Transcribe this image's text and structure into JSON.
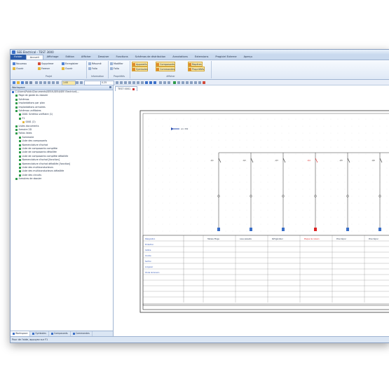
{
  "window": {
    "title": "SEE Electrical - TEST 3000"
  },
  "menu": {
    "items": [
      "Fichier",
      "Accueil",
      "Affichage",
      "Edition",
      "Afficher",
      "Dessiner",
      "Fonctions",
      "Schémas de distribution",
      "Annotations",
      "Extensions",
      "Progiciel Externe",
      "Aperçu"
    ]
  },
  "ribbon": {
    "projet": {
      "label": "Projet",
      "ouvrir": "Ouvrir",
      "fermer": "Fermer",
      "nouveau": "Nouveau",
      "supprimer": "Supprimer",
      "enregistrer": "Enregistrer",
      "ouvrir2": "Ouvrir"
    },
    "information": {
      "label": "Information",
      "resume": "Résumé",
      "folio": "Folio"
    },
    "proprietes": {
      "label": "Propriétés",
      "modifier": "Modifier",
      "folio": "Folio"
    },
    "afficher": {
      "label": "Afficher",
      "appareils": "Appareils",
      "symboles": "Symboles",
      "composants": "Composants",
      "commandes": "Commandes",
      "repere": "Repères",
      "proprietes": "Propriétés"
    }
  },
  "toolbar": {
    "zoom": "1:00",
    "scale": "0.25"
  },
  "workspace": {
    "title": "Workspace",
    "tree": [
      {
        "label": "C:\\Users\\Public\\Documents\\SEE4\\SEE4\\SEE Electrical\\...",
        "level": 0
      },
      {
        "label": "Page de garde du dossier",
        "level": 1
      },
      {
        "label": "Schémas",
        "level": 1
      },
      {
        "label": "Implantations par plan",
        "level": 1
      },
      {
        "label": "Implantations armoires",
        "level": 1
      },
      {
        "label": "Schémas unifilaires",
        "level": 1
      },
      {
        "label": "0001 Schéma unifilaire (1)",
        "level": 2
      },
      {
        "label": "F1",
        "level": 2
      },
      {
        "label": "0001 (2)",
        "level": 3
      },
      {
        "label": "Listes documents",
        "level": 1
      },
      {
        "label": "Armoire 2D",
        "level": 1
      },
      {
        "label": "Folios listes",
        "level": 1
      },
      {
        "label": "Sommaire",
        "level": 2
      },
      {
        "label": "Liste des composants",
        "level": 2
      },
      {
        "label": "Nomenclature d'achat",
        "level": 2
      },
      {
        "label": "Liste de composants complète",
        "level": 2
      },
      {
        "label": "Liste de composants détaillée",
        "level": 2
      },
      {
        "label": "Liste de composants complète détaillée",
        "level": 2
      },
      {
        "label": "Nomenclature d'achat [fonction]",
        "level": 2
      },
      {
        "label": "Nomenclature d'achat détaillée [fonction]",
        "level": 2
      },
      {
        "label": "Liste des multiconducteurs",
        "level": 2
      },
      {
        "label": "Liste des multiconducteurs détaillée",
        "level": 2
      },
      {
        "label": "Liste des circuits",
        "level": 2
      },
      {
        "label": "Armoires de dossier",
        "level": 1
      }
    ],
    "tabs": [
      "Workspace",
      "Symboles",
      "Composants",
      "Commandes"
    ]
  },
  "document": {
    "tab": "TEST 0001"
  },
  "status": "Pour de l'aide, appuyez sur F1",
  "schematic": {
    "source_label": "Arr. 330",
    "feeders": [
      {
        "ref": "-Q1",
        "desc": "Tableau Etage"
      },
      {
        "ref": "-Q2",
        "desc": "Lave-vaisselle"
      },
      {
        "ref": "-Q3",
        "desc": "Réfrigérateur"
      },
      {
        "ref": "-Q4",
        "desc": "Plaque de cuisson"
      },
      {
        "ref": "-Q5",
        "desc": "Prise Séjour"
      },
      {
        "ref": "-Q6",
        "desc": "Prise Séjour"
      }
    ],
    "rows": [
      "Désignation",
      "Protection",
      "Calibre",
      "Courbe",
      "Section",
      "Longueur",
      "Chute de tension"
    ]
  }
}
